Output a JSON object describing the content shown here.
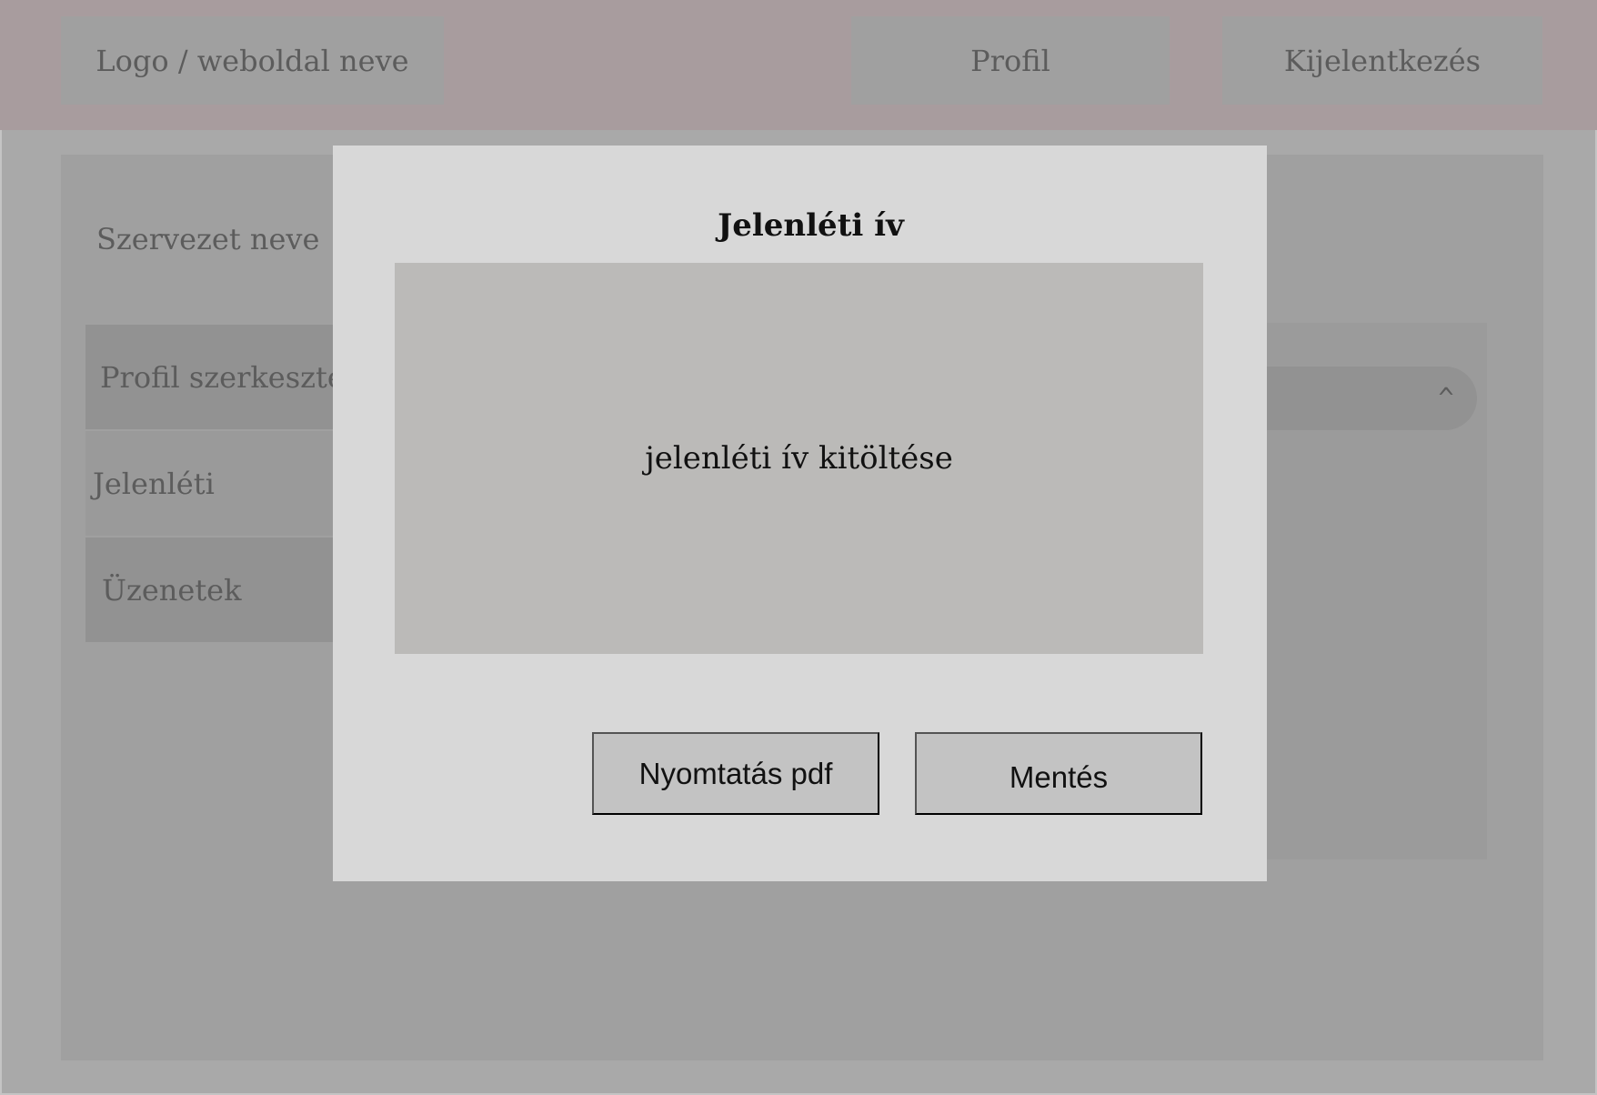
{
  "header": {
    "logo_label": "Logo / weboldal neve",
    "profile_label": "Profil",
    "logout_label": "Kijelentkezés"
  },
  "sidebar": {
    "org_name": "Szervezet neve",
    "items": [
      {
        "label": "Profil szerkesztése"
      },
      {
        "label": "Jelenléti"
      },
      {
        "label": "Üzenetek"
      }
    ]
  },
  "panel": {
    "collapse_icon": "chevron-up-icon",
    "collapse_glyph": "^"
  },
  "modal": {
    "title": "Jelenléti ív",
    "form_placeholder": "jelenléti ív kitöltése",
    "print_label": "Nyomtatás pdf",
    "save_label": "Mentés"
  },
  "colors": {
    "header_bg": "#a89c9e",
    "page_bg": "#a9a9a9",
    "modal_bg": "#d8d8d8",
    "form_bg": "#bbbab8",
    "button_bg": "#c3c3c3"
  }
}
